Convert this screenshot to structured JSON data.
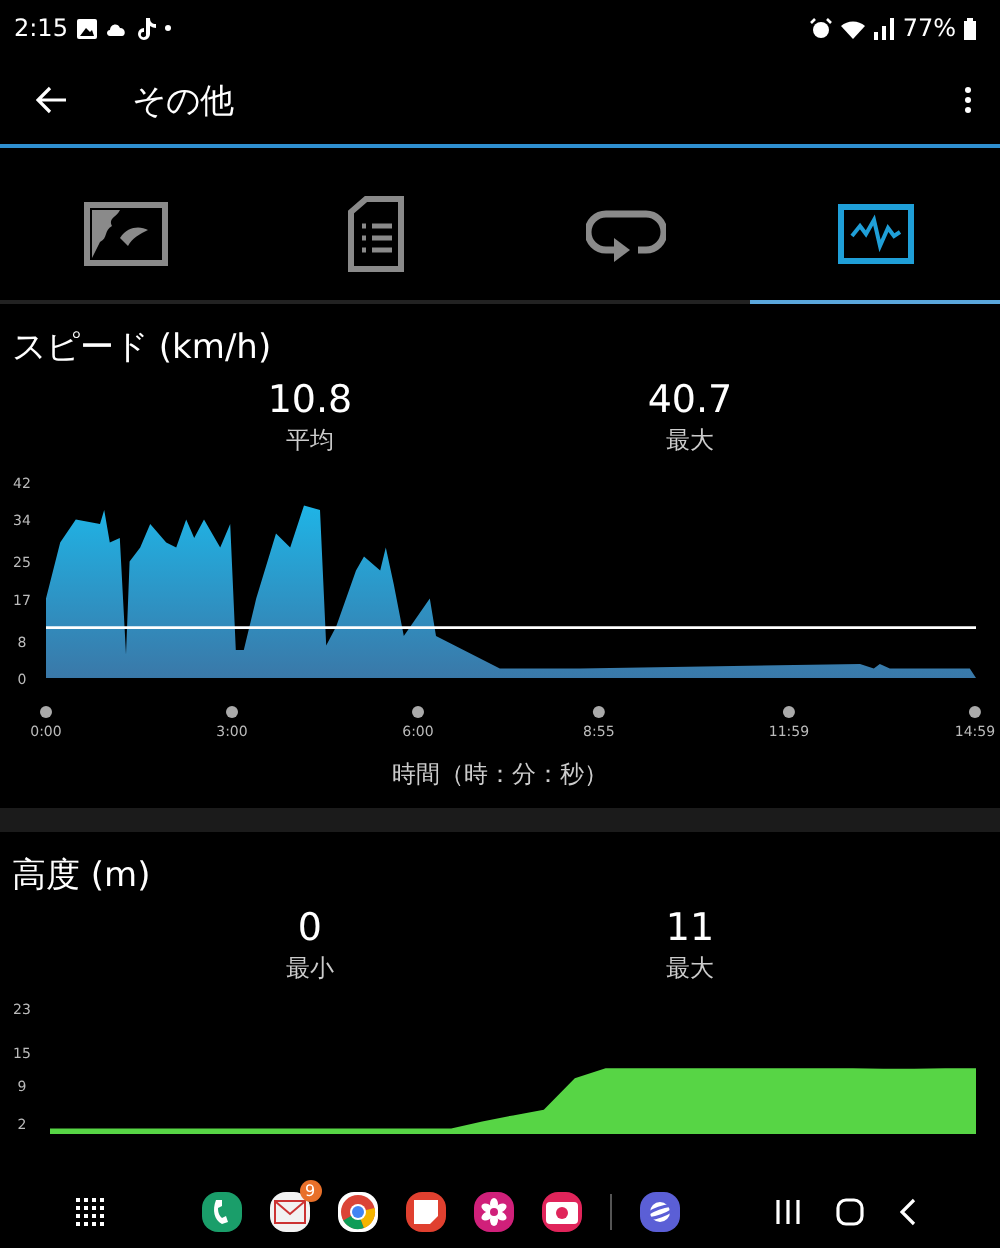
{
  "status_bar": {
    "time": "2:15",
    "battery": "77%"
  },
  "app_bar": {
    "title": "その他"
  },
  "tabs": [
    {
      "kind": "map",
      "selected": false
    },
    {
      "kind": "document",
      "selected": false
    },
    {
      "kind": "loop",
      "selected": false
    },
    {
      "kind": "chart",
      "selected": true
    }
  ],
  "sections": [
    {
      "title": "スピード (km/h)",
      "stats": [
        {
          "value": "10.8",
          "label": "平均"
        },
        {
          "value": "40.7",
          "label": "最大"
        }
      ],
      "chart_data": {
        "type": "area",
        "xlabel": "時間（時：分：秒）",
        "x": [
          0,
          0.23,
          0.48,
          0.87,
          0.94,
          1.03,
          1.19,
          1.29,
          1.35,
          1.52,
          1.68,
          1.94,
          2.1,
          2.26,
          2.39,
          2.55,
          2.81,
          2.97,
          3.06,
          3.19,
          3.39,
          3.71,
          3.94,
          4.16,
          4.42,
          4.52,
          4.68,
          5,
          5.13,
          5.39,
          5.48,
          5.61,
          5.77,
          6.19,
          6.29,
          7.32,
          8.29,
          8.61,
          13.13,
          13.35,
          13.45,
          13.61,
          14.42,
          14.9,
          15
        ],
        "series": [
          {
            "color": "#1fb4e6",
            "values": [
              17,
              29,
              34,
              33,
              36,
              29,
              30,
              5,
              25,
              28,
              33,
              29,
              28,
              34,
              30,
              34,
              28,
              33,
              6,
              6,
              17,
              31,
              28,
              37,
              36,
              7,
              11,
              23,
              26,
              23,
              28,
              20,
              9,
              17,
              9,
              2,
              2,
              2,
              3,
              2,
              3,
              2,
              2,
              2,
              0
            ]
          }
        ],
        "xlim": [
          0,
          15
        ],
        "ylim": [
          0,
          42
        ],
        "yticks": [
          0,
          8,
          17,
          25,
          34,
          42
        ],
        "xticks": [
          {
            "value": 0,
            "label": "0:00"
          },
          {
            "value": 3,
            "label": "3:00"
          },
          {
            "value": 6,
            "label": "6:00"
          },
          {
            "value": 8.917,
            "label": "8:55"
          },
          {
            "value": 11.983,
            "label": "11:59"
          },
          {
            "value": 14.983,
            "label": "14:59"
          }
        ],
        "ref_lines": [
          {
            "value": 10.8,
            "axis": "y"
          }
        ]
      }
    },
    {
      "title": "高度 (m)",
      "stats": [
        {
          "value": "0",
          "label": "最小"
        },
        {
          "value": "11",
          "label": "最大"
        }
      ],
      "chart_data": {
        "type": "area",
        "categories": [
          null,
          null,
          null,
          null,
          null,
          null,
          null,
          null,
          null,
          null,
          null,
          null,
          null,
          null,
          null,
          null,
          null,
          null,
          null,
          null,
          null,
          null,
          null,
          null,
          null,
          null,
          null,
          null,
          null,
          null,
          null
        ],
        "series": [
          {
            "color": "#57d545",
            "values": [
              1,
              1,
              1,
              1,
              1,
              1,
              1,
              1,
              1,
              1,
              1,
              1,
              1,
              1,
              2.3,
              3.4,
              4.4,
              10.2,
              12,
              12,
              12,
              12,
              12,
              12,
              12,
              12,
              12,
              11.9,
              11.9,
              12,
              12
            ]
          }
        ],
        "ylim": [
          0,
          23
        ],
        "yticks": [
          2,
          9,
          15,
          23
        ]
      }
    }
  ],
  "nav_bar": {
    "apps": [
      {
        "kind": "phone",
        "color": "#1a9e6a"
      },
      {
        "kind": "mail",
        "color": "#f2f2f2",
        "badge": "9"
      },
      {
        "kind": "browser",
        "color": "#ffffff"
      },
      {
        "kind": "notes",
        "color": "#e0402f"
      },
      {
        "kind": "flower",
        "color": "#d0207a"
      },
      {
        "kind": "camera",
        "color": "#e0245a"
      },
      {
        "kind": "planet",
        "color": "#5b5fd6"
      }
    ]
  }
}
